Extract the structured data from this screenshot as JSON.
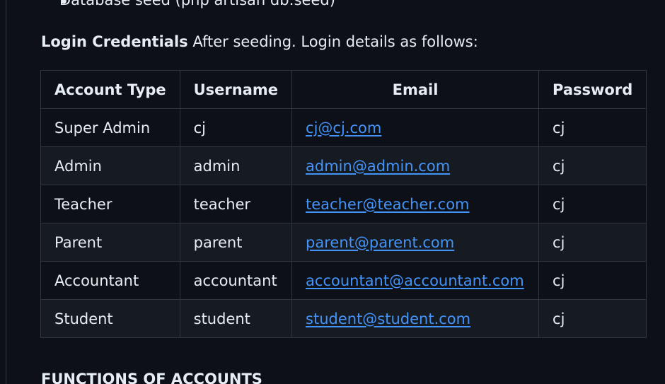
{
  "top_bullet": "Database seed (php artisan db:seed)",
  "intro": {
    "label": "Login Credentials",
    "text": "After seeding. Login details as follows:"
  },
  "table": {
    "headers": [
      "Account Type",
      "Username",
      "Email",
      "Password"
    ],
    "rows": [
      {
        "type": "Super Admin",
        "username": "cj",
        "email": "cj@cj.com",
        "password": "cj"
      },
      {
        "type": "Admin",
        "username": "admin",
        "email": "admin@admin.com",
        "password": "cj"
      },
      {
        "type": "Teacher",
        "username": "teacher",
        "email": "teacher@teacher.com",
        "password": "cj"
      },
      {
        "type": "Parent",
        "username": "parent",
        "email": "parent@parent.com",
        "password": "cj"
      },
      {
        "type": "Accountant",
        "username": "accountant",
        "email": "accountant@accountant.com",
        "password": "cj"
      },
      {
        "type": "Student",
        "username": "student",
        "email": "student@student.com",
        "password": "cj"
      }
    ]
  },
  "next_heading": "FUNCTIONS OF ACCOUNTS",
  "colors": {
    "background": "#0d1117",
    "text": "#e6edf3",
    "link": "#4493f8",
    "border": "#30363d",
    "stripe": "#161b22"
  }
}
